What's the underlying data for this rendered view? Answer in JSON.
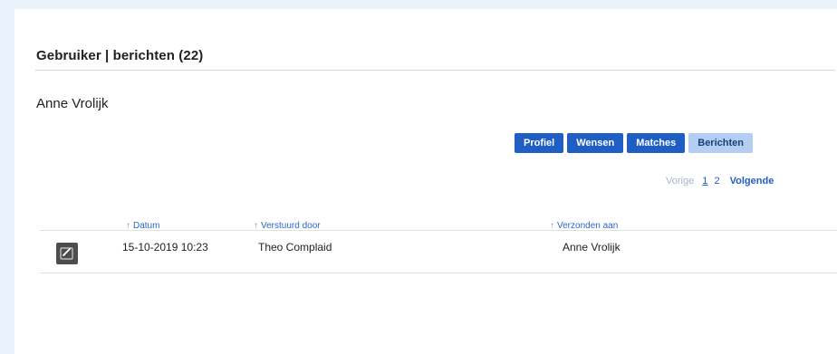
{
  "page": {
    "title": "Gebruiker | berichten (22)",
    "user_name": "Anne Vrolijk"
  },
  "tabs": [
    {
      "label": "Profiel",
      "active": false
    },
    {
      "label": "Wensen",
      "active": false
    },
    {
      "label": "Matches",
      "active": false
    },
    {
      "label": "Berichten",
      "active": true
    }
  ],
  "pager": {
    "prev_label": "Vorige",
    "pages": [
      "1",
      "2"
    ],
    "current_page": "1",
    "next_label": "Volgende"
  },
  "table": {
    "columns": [
      "Datum",
      "Verstuurd door",
      "Verzonden aan"
    ],
    "rows": [
      {
        "icon": "message-icon",
        "date": "15-10-2019 10:23",
        "sender": "Theo Complaid",
        "recipient": "Anne Vrolijk"
      }
    ]
  },
  "colors": {
    "tab_bg": "#1f5fc4",
    "tab_active_bg": "#b3cdf3",
    "link": "#1f5fc4",
    "page_bg": "#eaf2fc"
  }
}
